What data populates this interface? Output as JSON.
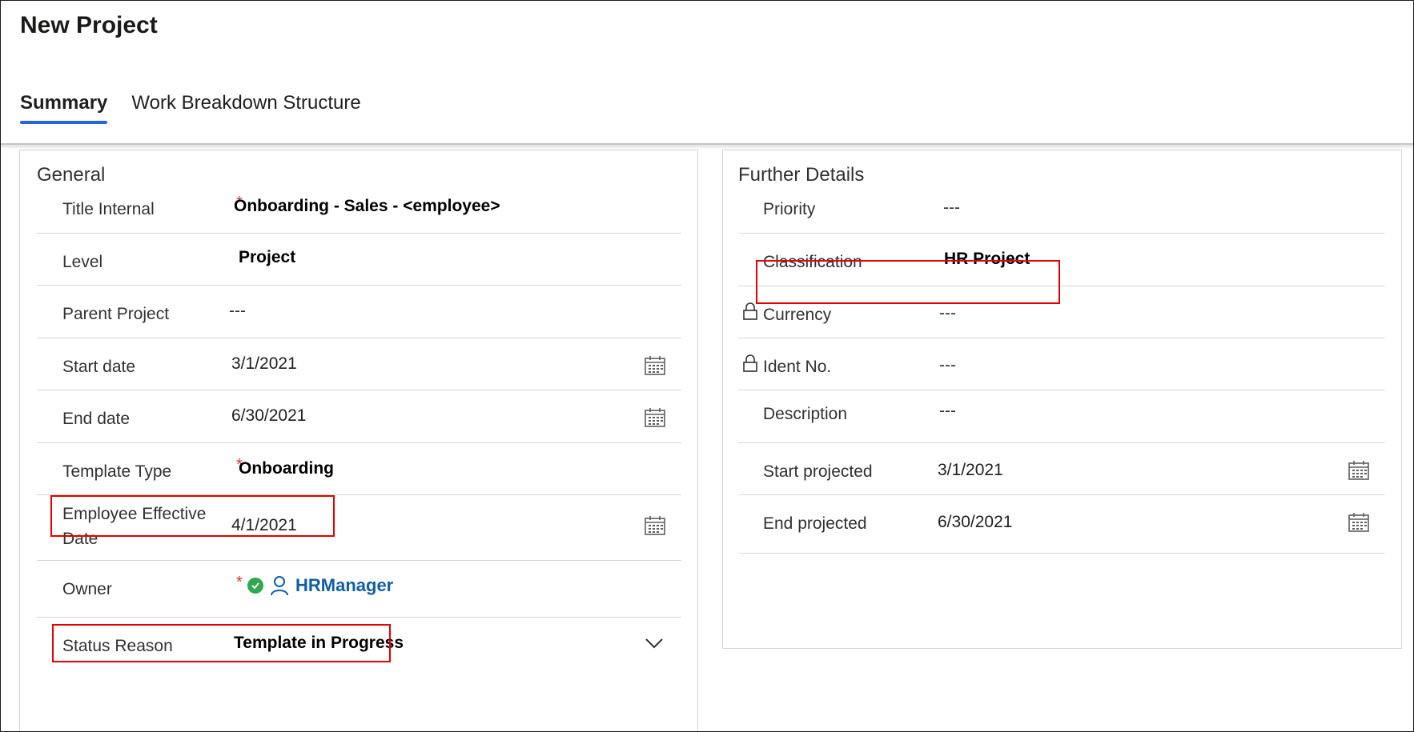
{
  "page": {
    "title": "New Project"
  },
  "tabs": [
    {
      "label": "Summary",
      "active": true
    },
    {
      "label": "Work Breakdown Structure",
      "active": false
    }
  ],
  "general": {
    "title": "General",
    "fields": {
      "title_internal": {
        "label": "Title Internal",
        "required": "*",
        "value": "Onboarding - Sales - <employee>"
      },
      "level": {
        "label": "Level",
        "value": "Project"
      },
      "parent_project": {
        "label": "Parent Project",
        "value": "---"
      },
      "start_date": {
        "label": "Start date",
        "value": "3/1/2021",
        "icon": "calendar-icon"
      },
      "end_date": {
        "label": "End date",
        "value": "6/30/2021",
        "icon": "calendar-icon"
      },
      "template_type": {
        "label": "Template Type",
        "required": "*",
        "value": "Onboarding"
      },
      "employee_effective_date": {
        "label": "Employee Effective Date",
        "value": "4/1/2021",
        "icon": "calendar-icon"
      },
      "owner": {
        "label": "Owner",
        "required": "*",
        "value": "HRManager",
        "icons": [
          "check-circle-icon",
          "person-icon"
        ]
      },
      "status_reason": {
        "label": "Status Reason",
        "value": "Template in Progress",
        "icon": "chevron-down-icon"
      }
    }
  },
  "further": {
    "title": "Further Details",
    "fields": {
      "priority": {
        "label": "Priority",
        "value": "---"
      },
      "classification": {
        "label": "Classification",
        "value": "HR Project"
      },
      "currency": {
        "label": "Currency",
        "value": "---",
        "icon": "lock-icon"
      },
      "ident_no": {
        "label": "Ident No.",
        "value": "---",
        "icon": "lock-icon"
      },
      "description": {
        "label": "Description",
        "value": "---"
      },
      "start_projected": {
        "label": "Start projected",
        "value": "3/1/2021",
        "icon": "calendar-icon"
      },
      "end_projected": {
        "label": "End projected",
        "value": "6/30/2021",
        "icon": "calendar-icon"
      }
    }
  },
  "colors": {
    "accent": "#2266e3",
    "required": "#d13438",
    "highlight": "#e00000",
    "link": "#115ea3",
    "success": "#2fa84f"
  }
}
